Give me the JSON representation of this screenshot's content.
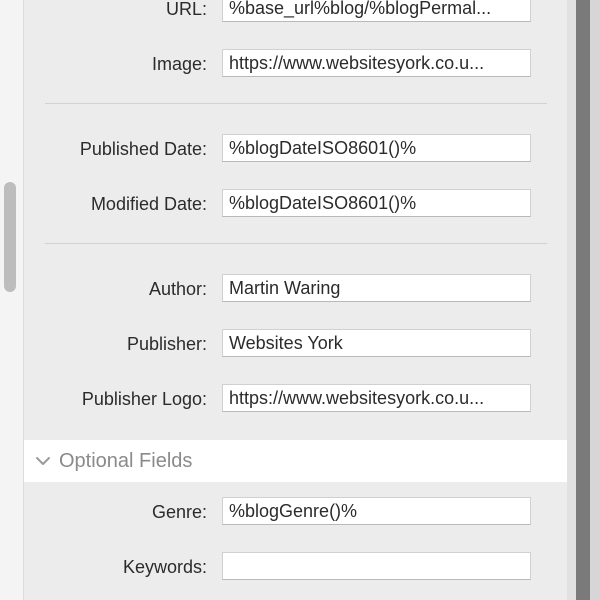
{
  "form": {
    "url": {
      "label": "URL:",
      "value": "%base_url%blog/%blogPermal..."
    },
    "image": {
      "label": "Image:",
      "value": "https://www.websitesyork.co.u..."
    },
    "published_date": {
      "label": "Published Date:",
      "value": "%blogDateISO8601()%"
    },
    "modified_date": {
      "label": "Modified Date:",
      "value": "%blogDateISO8601()%"
    },
    "author": {
      "label": "Author:",
      "value": "Martin Waring"
    },
    "publisher": {
      "label": "Publisher:",
      "value": "Websites York"
    },
    "publisher_logo": {
      "label": "Publisher Logo:",
      "value": "https://www.websitesyork.co.u..."
    }
  },
  "optional_section": {
    "title": "Optional Fields",
    "icon": "chevron-down-icon",
    "genre": {
      "label": "Genre:",
      "value": "%blogGenre()%"
    },
    "keywords": {
      "label": "Keywords:",
      "value": ""
    }
  }
}
